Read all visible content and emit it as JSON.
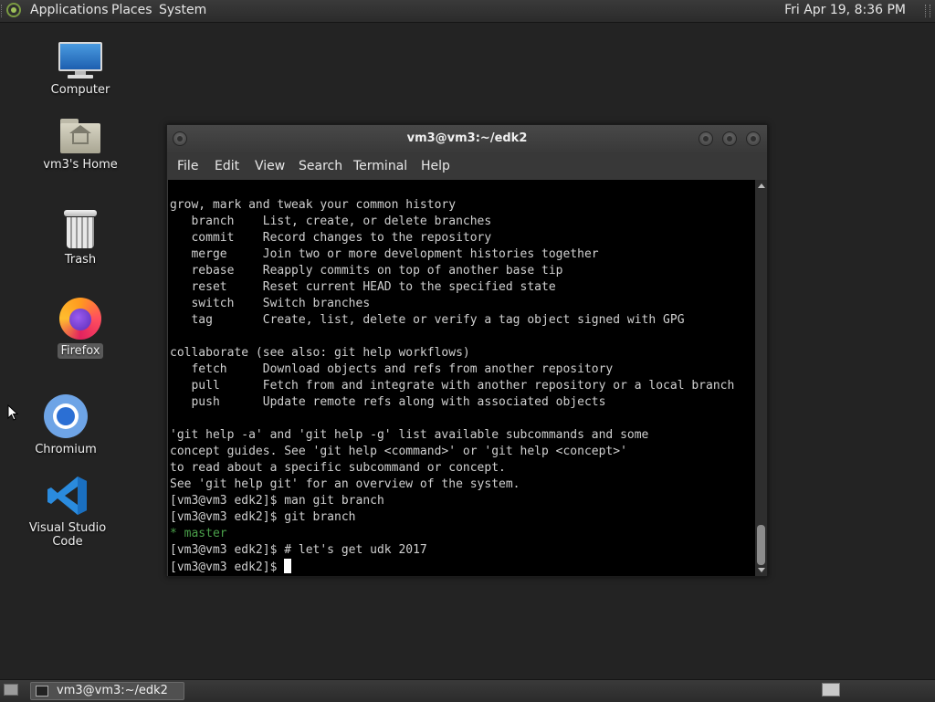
{
  "top_panel": {
    "menus": [
      "Applications",
      "Places",
      "System"
    ],
    "clock": "Fri Apr 19,  8:36 PM"
  },
  "desktop_icons": {
    "computer": "Computer",
    "home": "vm3's Home",
    "trash": "Trash",
    "firefox": "Firefox",
    "chromium": "Chromium",
    "vscode": "Visual Studio Code"
  },
  "window": {
    "title": "vm3@vm3:~/edk2",
    "menu": [
      "File",
      "Edit",
      "View",
      "Search",
      "Terminal",
      "Help"
    ]
  },
  "terminal": {
    "lines": [
      "grow, mark and tweak your common history",
      "   branch    List, create, or delete branches",
      "   commit    Record changes to the repository",
      "   merge     Join two or more development histories together",
      "   rebase    Reapply commits on top of another base tip",
      "   reset     Reset current HEAD to the specified state",
      "   switch    Switch branches",
      "   tag       Create, list, delete or verify a tag object signed with GPG",
      "",
      "collaborate (see also: git help workflows)",
      "   fetch     Download objects and refs from another repository",
      "   pull      Fetch from and integrate with another repository or a local branch",
      "   push      Update remote refs along with associated objects",
      "",
      "'git help -a' and 'git help -g' list available subcommands and some",
      "concept guides. See 'git help <command>' or 'git help <concept>'",
      "to read about a specific subcommand or concept.",
      "See 'git help git' for an overview of the system.",
      "[vm3@vm3 edk2]$ man git branch",
      "[vm3@vm3 edk2]$ git branch",
      "* master",
      "[vm3@vm3 edk2]$ # let's get udk 2017",
      "[vm3@vm3 edk2]$ "
    ]
  },
  "taskbar": {
    "task_label": "vm3@vm3:~/edk2"
  },
  "colors": {
    "desktop_bg": "#232323",
    "terminal_bg": "#000000",
    "branch_green": "#4aa04a"
  }
}
